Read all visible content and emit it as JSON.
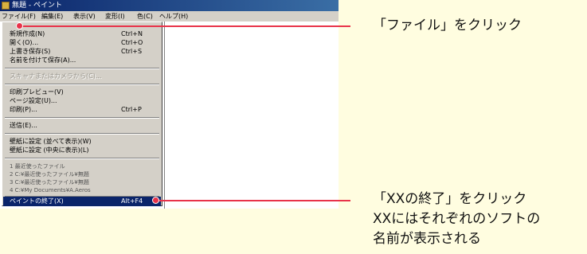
{
  "window": {
    "title": "無題 - ペイント"
  },
  "menubar": {
    "items": [
      "ファイル(F)",
      "編集(E)",
      "表示(V)",
      "変形(I)",
      "色(C)",
      "ヘルプ(H)"
    ]
  },
  "file_menu": {
    "items": [
      {
        "label": "新規作成(N)",
        "shortcut": "Ctrl+N"
      },
      {
        "label": "開く(O)...",
        "shortcut": "Ctrl+O"
      },
      {
        "label": "上書き保存(S)",
        "shortcut": "Ctrl+S"
      },
      {
        "label": "名前を付けて保存(A)...",
        "shortcut": ""
      },
      {
        "label": "スキャナまたはカメラから(C)...",
        "shortcut": ""
      },
      {
        "label": "印刷プレビュー(V)",
        "shortcut": ""
      },
      {
        "label": "ページ設定(U)...",
        "shortcut": ""
      },
      {
        "label": "印刷(P)...",
        "shortcut": "Ctrl+P"
      },
      {
        "label": "送信(E)...",
        "shortcut": ""
      },
      {
        "label": "壁紙に設定 (並べて表示)(W)",
        "shortcut": ""
      },
      {
        "label": "壁紙に設定 (中央に表示)(L)",
        "shortcut": ""
      },
      {
        "label": "1 最近使ったファイル",
        "shortcut": ""
      },
      {
        "label": "2 C:¥最近使ったファイル¥無題",
        "shortcut": ""
      },
      {
        "label": "3 C:¥最近使ったファイル¥無題",
        "shortcut": ""
      },
      {
        "label": "4 C:¥My Documents¥A.Aeros",
        "shortcut": ""
      },
      {
        "label": "ペイントの終了(X)",
        "shortcut": "Alt+F4"
      }
    ]
  },
  "annotations": {
    "click_file": "「ファイル」をクリック",
    "click_exit_line1": "「XXの終了」をクリック",
    "click_exit_line2": "XXにはそれぞれのソフトの",
    "click_exit_line3": "名前が表示される"
  },
  "colors": {
    "accent": "#e8334a",
    "background": "#fffde0",
    "menu_highlight": "#0a246a",
    "menu_face": "#d4d0c8"
  }
}
